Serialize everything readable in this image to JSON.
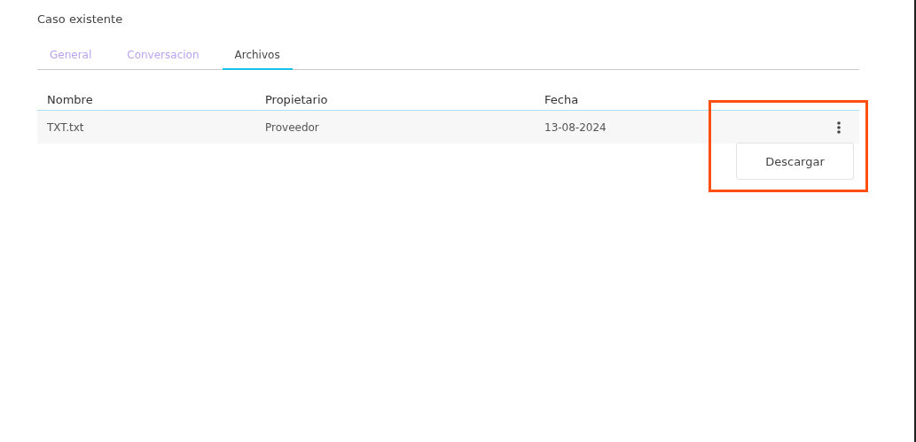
{
  "title": "Caso existente",
  "tabs": [
    {
      "label": "General",
      "selected": false
    },
    {
      "label": "Conversacion",
      "selected": false
    },
    {
      "label": "Archivos",
      "selected": true
    }
  ],
  "table": {
    "columns": [
      "Nombre",
      "Propietario",
      "Fecha"
    ],
    "rows": [
      {
        "cells": [
          "TXT.txt",
          "Proveedor",
          "13-08-2024"
        ],
        "menu": {
          "expanded": true,
          "items": [
            "Descargar"
          ]
        }
      }
    ]
  },
  "annotation": {
    "highlight": true
  }
}
